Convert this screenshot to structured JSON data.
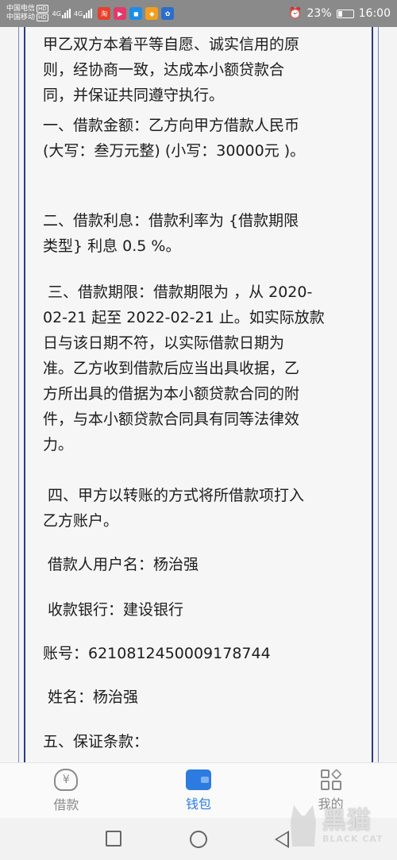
{
  "status_bar": {
    "carrier_1": "中国电信",
    "carrier_2": "中国移动",
    "net_badge": "HD",
    "signal_label": "4G",
    "app_icons": [
      "shop-icon",
      "video-icon",
      "tv-icon",
      "app-icon",
      "gallery-icon"
    ],
    "battery_percent": "23%",
    "time": "16:00"
  },
  "document": {
    "paragraphs": [
      "甲乙双方本着平等自愿、诚实信用的原\n则，经协商一致，达成本小额贷款合\n同，并保证共同遵守执行。",
      "一、借款金额：乙方向甲方借款人民币\n(大写：叁万元整) (小写：30000元 )。",
      "二、借款利息：借款利率为 {借款期限\n类型} 利息 0.5 %。",
      " 三、借款期限：借款期限为 ，从 2020-\n02-21 起至 2022-02-21 止。如实际放款\n日与该日期不符，以实际借款日期为\n准。乙方收到借款后应当出具收据，乙\n方所出具的借据为本小额贷款合同的附\n件，与本小额贷款合同具有同等法律效\n力。",
      " 四、甲方以转账的方式将所借款项打入\n乙方账户。",
      " 借款人用户名：杨治强",
      " 收款银行：建设银行",
      "账号：6210812450009178744",
      " 姓名：杨治强",
      "五、保证条款："
    ]
  },
  "bottom_nav": {
    "items": [
      {
        "label": "借款",
        "icon": "loan-icon",
        "active": false
      },
      {
        "label": "钱包",
        "icon": "wallet-icon",
        "active": true
      },
      {
        "label": "我的",
        "icon": "profile-grid-icon",
        "active": false
      }
    ]
  },
  "watermark": {
    "big": "黑猫",
    "small": "BLACK CAT"
  },
  "colors": {
    "accent": "#2d7be0",
    "border": "#2a3a8c",
    "status_bar": "#8a8a8a"
  }
}
